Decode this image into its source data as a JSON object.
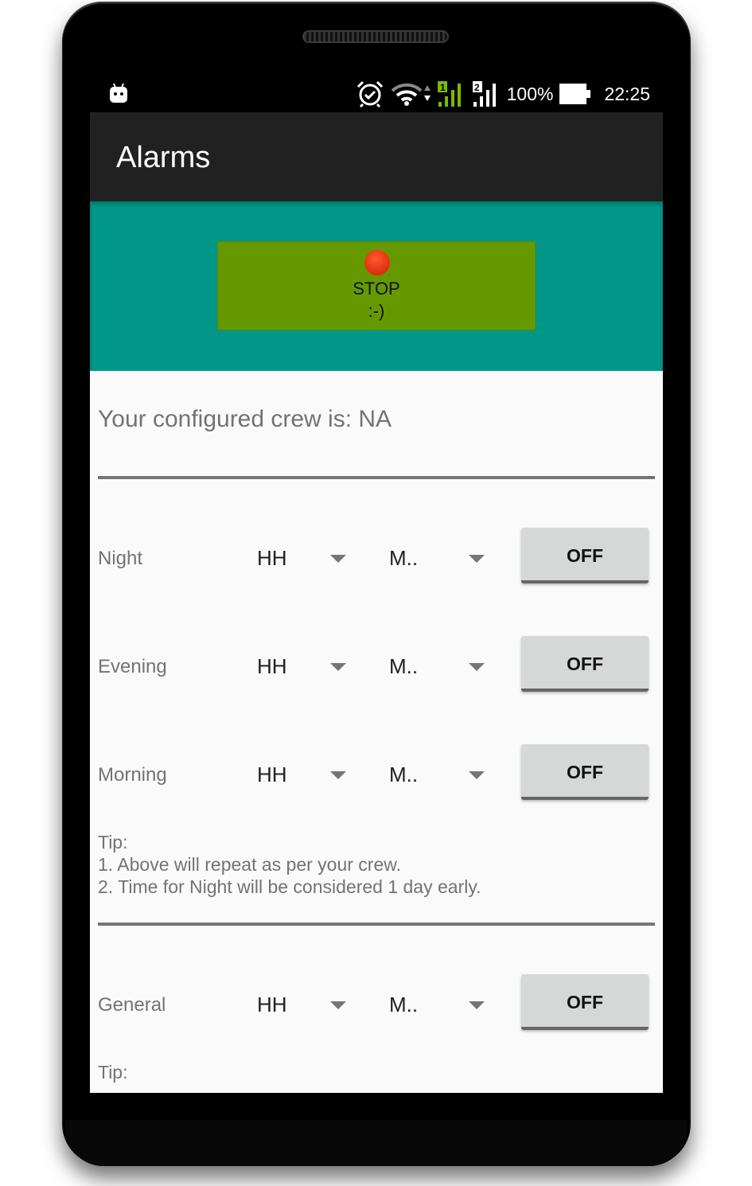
{
  "status_bar": {
    "icons": [
      "android-debug-icon",
      "alarm-icon",
      "wifi-icon",
      "sim1-signal-icon",
      "sim2-signal-icon",
      "battery-icon"
    ],
    "battery": "100%",
    "time": "22:25",
    "sim1_label": "1",
    "sim2_label": "2"
  },
  "app_bar": {
    "title": "Alarms"
  },
  "banner": {
    "stop_button": {
      "label": "STOP",
      "sublabel": ":-)",
      "icon": "red-dot-icon"
    },
    "colors": {
      "banner": "#009688",
      "button": "#669900",
      "dot": "#e03010"
    }
  },
  "crew_text": "Your configured crew is: NA",
  "alarms": [
    {
      "label": "Night",
      "hour": "HH",
      "minute": "M..",
      "toggle": "OFF"
    },
    {
      "label": "Evening",
      "hour": "HH",
      "minute": "M..",
      "toggle": "OFF"
    },
    {
      "label": "Morning",
      "hour": "HH",
      "minute": "M..",
      "toggle": "OFF"
    }
  ],
  "tip1": {
    "title": "Tip:",
    "lines": [
      "1. Above will repeat as per your crew.",
      "2. Time for Night will be considered 1 day early."
    ]
  },
  "general": {
    "label": "General",
    "hour": "HH",
    "minute": "M..",
    "toggle": "OFF"
  },
  "tip2": {
    "title": "Tip:"
  }
}
